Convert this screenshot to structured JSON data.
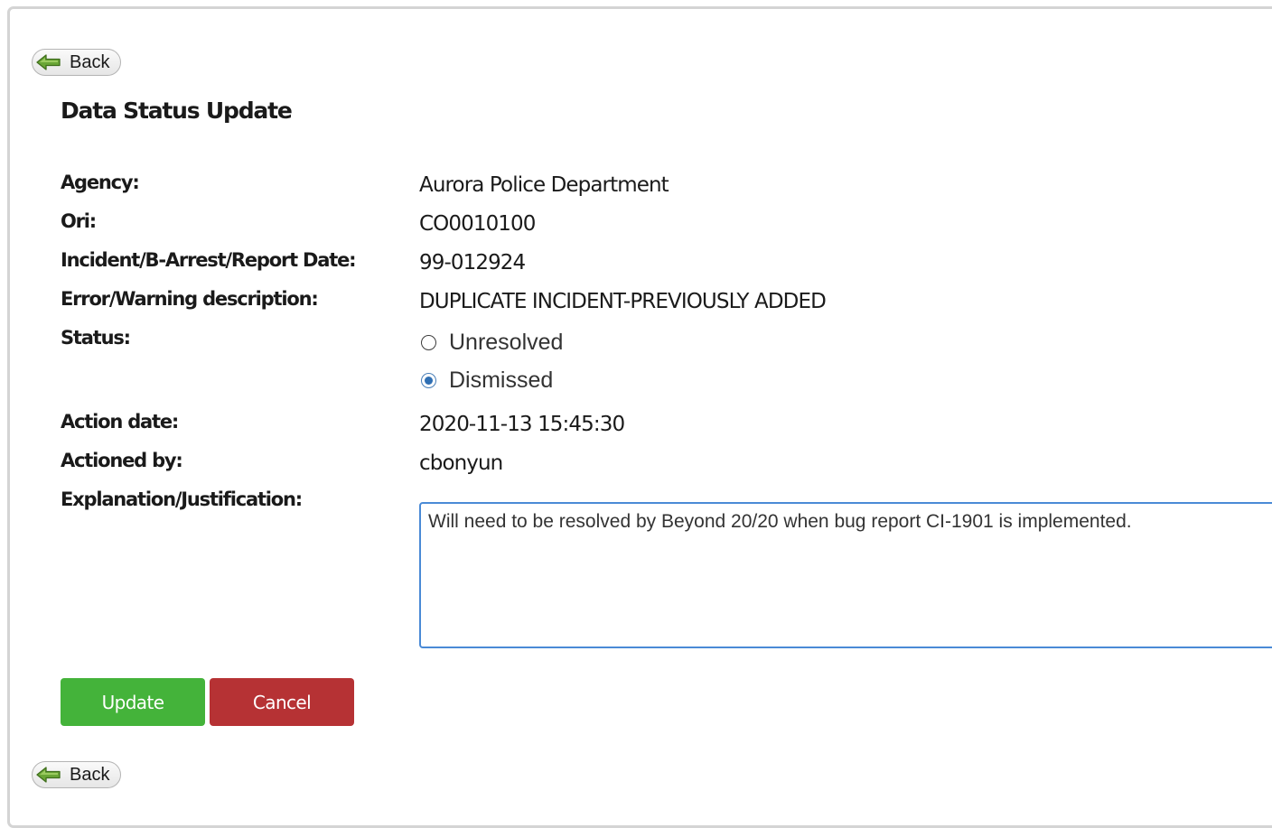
{
  "nav": {
    "back_label": "Back"
  },
  "page": {
    "title": "Data Status Update"
  },
  "fields": {
    "agency": {
      "label": "Agency:",
      "value": "Aurora Police Department"
    },
    "ori": {
      "label": "Ori:",
      "value": "CO0010100"
    },
    "incident": {
      "label": "Incident/B-Arrest/Report Date:",
      "value": "99-012924"
    },
    "error": {
      "label": "Error/Warning description:",
      "value": "DUPLICATE INCIDENT-PREVIOUSLY ADDED"
    },
    "status": {
      "label": "Status:",
      "options": [
        {
          "label": "Unresolved",
          "checked": false
        },
        {
          "label": "Dismissed",
          "checked": true
        }
      ]
    },
    "action_date": {
      "label": "Action date:",
      "value": "2020-11-13 15:45:30"
    },
    "actioned_by": {
      "label": "Actioned by:",
      "value": "cbonyun"
    },
    "explanation": {
      "label": "Explanation/Justification:",
      "value": "Will need to be resolved by Beyond 20/20 when bug report CI-1901 is implemented."
    }
  },
  "actions": {
    "update_label": "Update",
    "cancel_label": "Cancel"
  },
  "colors": {
    "update": "#44b33a",
    "cancel": "#b63234",
    "focus_border": "#4a8ad6",
    "back_arrow": "#5c9a2e"
  },
  "icons": {
    "back": "back-arrow-icon"
  }
}
